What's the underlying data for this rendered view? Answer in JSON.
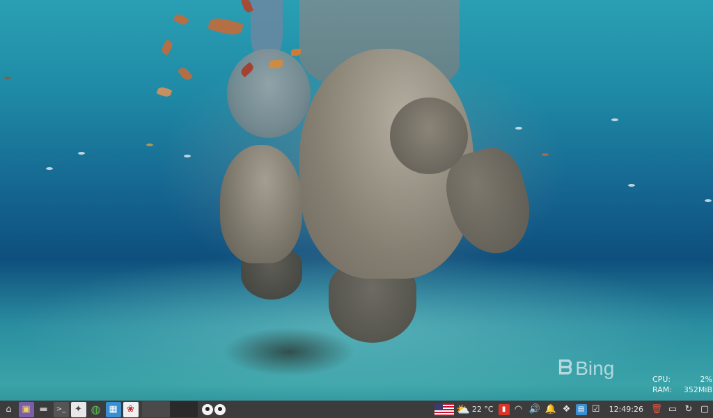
{
  "wallpaper": {
    "watermark": "Bing"
  },
  "system_monitor": {
    "cpu_label": "CPU:",
    "cpu_value": "2%",
    "ram_label": "RAM:",
    "ram_value": "352MiB"
  },
  "taskbar": {
    "launchers": [
      {
        "icon": "home-icon",
        "glyph": "⌂"
      },
      {
        "icon": "app-menu-icon",
        "glyph": "▣"
      },
      {
        "icon": "folder-icon",
        "glyph": "▬"
      },
      {
        "icon": "terminal-icon",
        "glyph": ">_"
      },
      {
        "icon": "settings-icon",
        "glyph": "✦"
      },
      {
        "icon": "globe-icon",
        "glyph": "◍"
      },
      {
        "icon": "image-viewer-icon",
        "glyph": "▦"
      },
      {
        "icon": "cherry-icon",
        "glyph": "❀"
      }
    ],
    "weather": {
      "icon": "weather-partly-cloudy-icon",
      "temperature": "22 °C"
    },
    "tray": [
      {
        "icon": "wifi-icon",
        "glyph": "◠"
      },
      {
        "icon": "volume-icon",
        "glyph": "🔊"
      },
      {
        "icon": "notification-bell-icon",
        "glyph": "🔔"
      },
      {
        "icon": "dropbox-icon",
        "glyph": "❖"
      },
      {
        "icon": "notes-icon",
        "glyph": "▤"
      },
      {
        "icon": "tasks-icon",
        "glyph": "☑"
      }
    ],
    "clock": "12:49:26",
    "end_icons": [
      {
        "icon": "trash-icon",
        "glyph": "🗑"
      },
      {
        "icon": "drive-icon",
        "glyph": "▭"
      },
      {
        "icon": "update-icon",
        "glyph": "↻"
      },
      {
        "icon": "display-icon",
        "glyph": "▢"
      }
    ],
    "colors": {
      "background": "#3c3c3c",
      "accent_red": "#d9352b",
      "accent_blue": "#3a8fd1"
    }
  }
}
